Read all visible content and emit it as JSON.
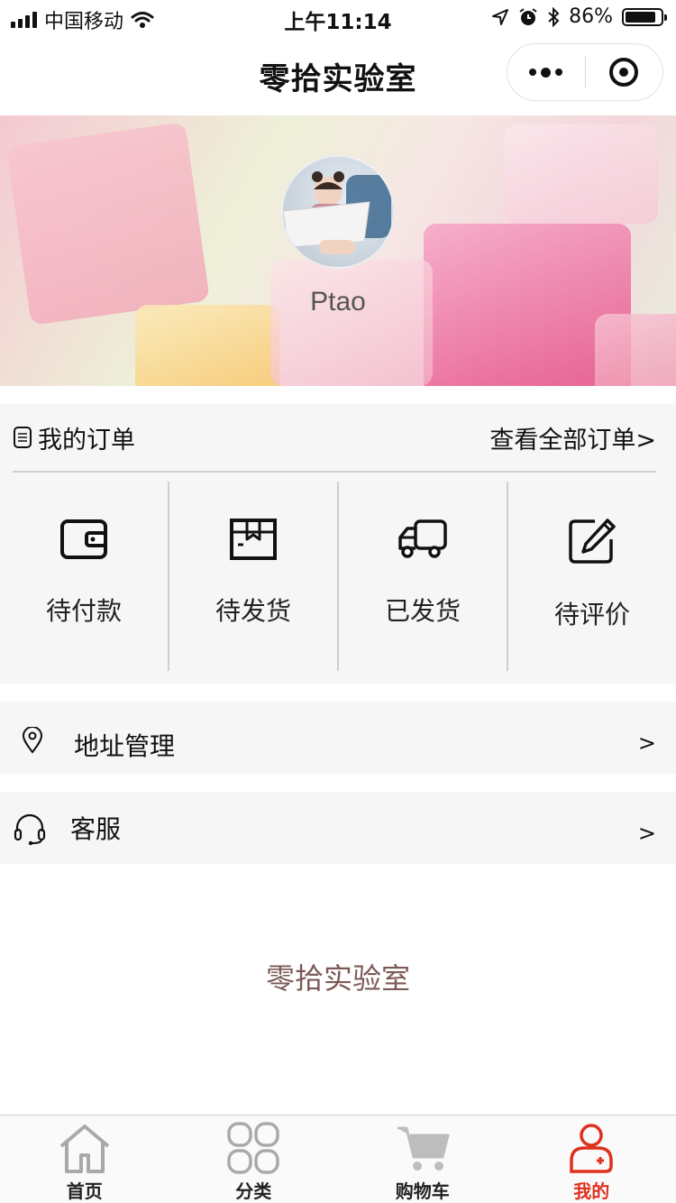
{
  "status_bar": {
    "carrier": "中国移动",
    "time": "上午11:14",
    "battery": "86%",
    "battery_level": 0.86
  },
  "nav": {
    "title": "零拾实验室"
  },
  "profile": {
    "username": "Ptao"
  },
  "orders": {
    "title": "我的订单",
    "view_all": "查看全部订单>",
    "items": [
      {
        "label": "待付款",
        "icon": "wallet-icon"
      },
      {
        "label": "待发货",
        "icon": "package-icon"
      },
      {
        "label": "已发货",
        "icon": "truck-icon"
      },
      {
        "label": "待评价",
        "icon": "edit-icon"
      }
    ]
  },
  "menu": {
    "address": {
      "label": "地址管理",
      "arrow": ">",
      "icon": "location-pin-icon"
    },
    "service": {
      "label": "客服",
      "arrow": ">",
      "icon": "headset-icon"
    }
  },
  "footer": {
    "brand": "零拾实验室"
  },
  "tabbar": {
    "items": [
      {
        "label": "首页",
        "icon": "home-icon"
      },
      {
        "label": "分类",
        "icon": "grid-icon"
      },
      {
        "label": "购物车",
        "icon": "cart-icon"
      },
      {
        "label": "我的",
        "icon": "user-icon"
      }
    ],
    "active_index": 3,
    "active_color": "#e0301e"
  }
}
